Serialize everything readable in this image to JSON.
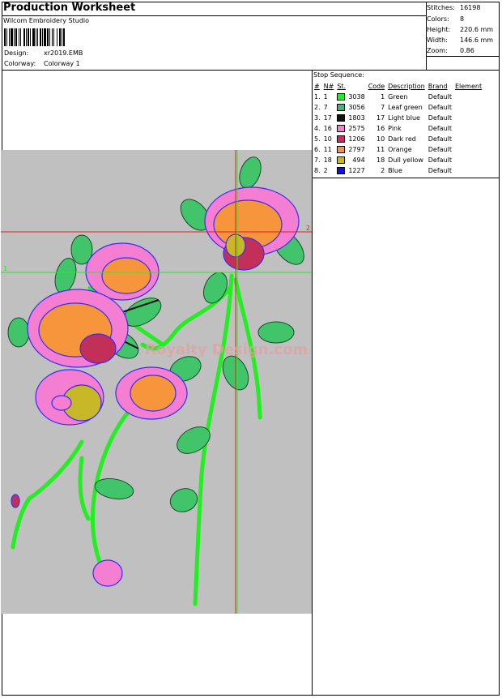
{
  "header": {
    "title": "Production Worksheet",
    "company": "Wilcom  Embroidery Studio",
    "design_label": "Design:",
    "design_value": "xr2019.EMB",
    "colorway_label": "Colorway:",
    "colorway_value": "Colorway 1"
  },
  "stats": {
    "stitches_label": "Stitches:",
    "stitches_value": "16198",
    "colors_label": "Colors:",
    "colors_value": "8",
    "height_label": "Height:",
    "height_value": "220.6 mm",
    "width_label": "Width:",
    "width_value": "146.6 mm",
    "zoom_label": "Zoom:",
    "zoom_value": "0.86"
  },
  "design": {
    "watermark": "Royalty Design.com",
    "marker_1": "1",
    "marker_2": "2",
    "bg_color": "#c0c0c0"
  },
  "sequence": {
    "title": "Stop Sequence:",
    "headers": [
      "#",
      "N#",
      "St.",
      "Code",
      "Description",
      "Brand",
      "Element"
    ],
    "rows": [
      {
        "idx": "1.",
        "n": "1",
        "color": "#22ee22",
        "st": "3038",
        "code": "1",
        "desc": "Green",
        "brand": "Default"
      },
      {
        "idx": "2.",
        "n": "7",
        "color": "#3cb878",
        "st": "3056",
        "code": "7",
        "desc": "Leaf green",
        "brand": "Default"
      },
      {
        "idx": "3.",
        "n": "17",
        "color": "#111111",
        "st": "1803",
        "code": "17",
        "desc": "Light blue",
        "brand": "Default"
      },
      {
        "idx": "4.",
        "n": "16",
        "color": "#f47ed2",
        "st": "2575",
        "code": "16",
        "desc": "Pink",
        "brand": "Default"
      },
      {
        "idx": "5.",
        "n": "10",
        "color": "#c2305a",
        "st": "1206",
        "code": "10",
        "desc": "Dark red",
        "brand": "Default"
      },
      {
        "idx": "6.",
        "n": "11",
        "color": "#f6953c",
        "st": "2797",
        "code": "11",
        "desc": "Orange",
        "brand": "Default"
      },
      {
        "idx": "7.",
        "n": "18",
        "color": "#c8b828",
        "st": "494",
        "code": "18",
        "desc": "Dull yellow",
        "brand": "Default"
      },
      {
        "idx": "8.",
        "n": "2",
        "color": "#1010ee",
        "st": "1227",
        "code": "2",
        "desc": "Blue",
        "brand": "Default"
      }
    ]
  }
}
